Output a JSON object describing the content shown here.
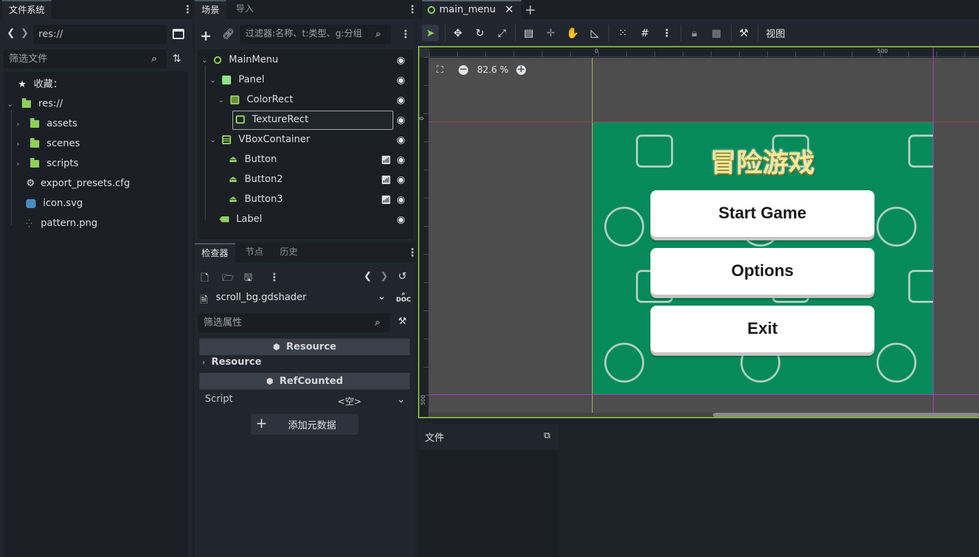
{
  "filesystem": {
    "tab": "文件系统",
    "path": "res://",
    "filter_placeholder": "筛选文件",
    "favorites": "收藏：",
    "root": "res://",
    "items": [
      {
        "name": "assets",
        "kind": "folder"
      },
      {
        "name": "scenes",
        "kind": "folder"
      },
      {
        "name": "scripts",
        "kind": "folder"
      },
      {
        "name": "export_presets.cfg",
        "kind": "gear"
      },
      {
        "name": "icon.svg",
        "kind": "svg"
      },
      {
        "name": "pattern.png",
        "kind": "image"
      }
    ]
  },
  "scene": {
    "tabs": [
      "场景",
      "导入"
    ],
    "filter_placeholder": "过滤器:名称、t:类型、g:分组",
    "nodes": [
      {
        "name": "MainMenu",
        "type": "Control"
      },
      {
        "name": "Panel",
        "type": "Panel"
      },
      {
        "name": "ColorRect",
        "type": "ColorRect"
      },
      {
        "name": "TextureRect",
        "type": "TextureRect"
      },
      {
        "name": "VBoxContainer",
        "type": "VBoxContainer"
      },
      {
        "name": "Button",
        "type": "Button"
      },
      {
        "name": "Button2",
        "type": "Button"
      },
      {
        "name": "Button3",
        "type": "Button"
      },
      {
        "name": "Label",
        "type": "Label"
      }
    ]
  },
  "inspector": {
    "tabs": [
      "检查器",
      "节点",
      "历史"
    ],
    "resource_name": "scroll_bg.gdshader",
    "filter_placeholder": "筛选属性",
    "section1": "Resource",
    "group1": "Resource",
    "section2": "RefCounted",
    "script_label": "Script",
    "script_value": "<空>",
    "add_metadata": "添加元数据"
  },
  "editor": {
    "tab_title": "main_menu",
    "view_menu": "视图",
    "zoom": "82.6 %",
    "ruler_0": "0",
    "ruler_500": "500",
    "vruler_0": "0",
    "vruler_500": "500"
  },
  "game": {
    "title": "冒险游戏",
    "buttons": [
      "Start Game",
      "Options",
      "Exit"
    ],
    "bg_color": "#068a5b"
  },
  "bottom": {
    "files_label": "文件"
  },
  "colors": {
    "accent_green": "#8fcf5a",
    "viewport_border": "#7fb03d",
    "guide_yellow": "#bfb23f",
    "guide_purple": "#a040d0",
    "guide_red": "#b0404a"
  }
}
